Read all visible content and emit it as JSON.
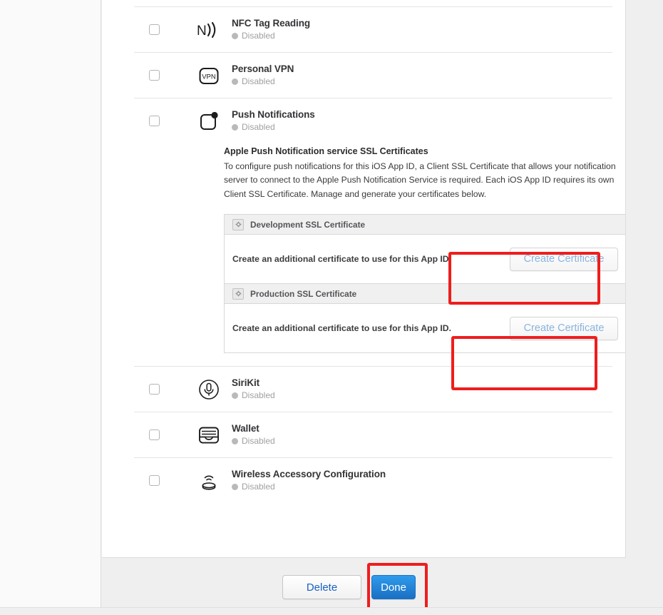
{
  "colors": {
    "annotation": "#ef1d1d",
    "primary_button": "#1a6fc4",
    "link_text": "#1861c4",
    "disabled_button_text": "#8ab4de",
    "panel_bg": "#ffffff",
    "footer_bg": "#efeff0",
    "status_dot": "#b9b9bc"
  },
  "capabilities": [
    {
      "name": "NFC Tag Reading",
      "status": "Disabled",
      "icon": "nfc-icon",
      "checkbox_checked": false
    },
    {
      "name": "Personal VPN",
      "status": "Disabled",
      "icon": "vpn-icon",
      "icon_label": "VPN",
      "checkbox_checked": false
    },
    {
      "name": "Push Notifications",
      "status": "Disabled",
      "icon": "push-notifications-icon",
      "checkbox_checked": false
    },
    {
      "name": "SiriKit",
      "status": "Disabled",
      "icon": "siri-microphone-icon",
      "checkbox_checked": false
    },
    {
      "name": "Wallet",
      "status": "Disabled",
      "icon": "wallet-icon",
      "checkbox_checked": false
    },
    {
      "name": "Wireless Accessory Configuration",
      "status": "Disabled",
      "icon": "wireless-accessory-icon",
      "checkbox_checked": false
    }
  ],
  "push_detail": {
    "title": "Apple Push Notification service SSL Certificates",
    "description": "To configure push notifications for this iOS App ID, a Client SSL Certificate that allows your notification server to connect to the Apple Push Notification Service is required. Each iOS App ID requires its own Client SSL Certificate. Manage and generate your certificates below.",
    "tables": [
      {
        "header": "Development SSL Certificate",
        "header_icon": "certificate-icon",
        "body_text": "Create an additional certificate to use for this App ID.",
        "button_label": "Create Certificate"
      },
      {
        "header": "Production SSL Certificate",
        "header_icon": "certificate-icon",
        "body_text": "Create an additional certificate to use for this App ID.",
        "button_label": "Create Certificate"
      }
    ]
  },
  "footer": {
    "delete_label": "Delete",
    "done_label": "Done"
  }
}
